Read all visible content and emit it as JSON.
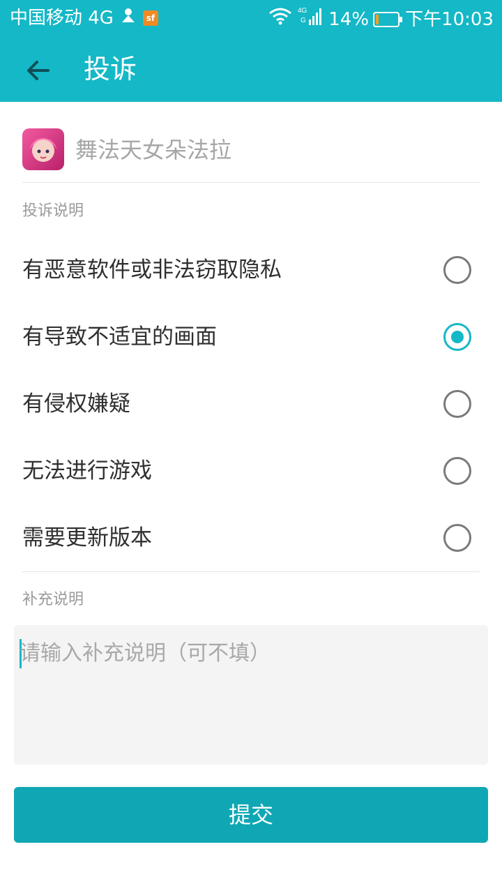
{
  "status_bar": {
    "carrier": "中国移动 4G",
    "network_small": "4G",
    "battery_percent": "14%",
    "battery_level": 0.14,
    "time": "下午10:03"
  },
  "app_bar": {
    "title": "投诉",
    "back_icon": "arrow-left-icon"
  },
  "app_info": {
    "name": "舞法天女朵法拉"
  },
  "complaint": {
    "section_label": "投诉说明",
    "options": [
      {
        "label": "有恶意软件或非法窃取隐私",
        "selected": false
      },
      {
        "label": "有导致不适宜的画面",
        "selected": true
      },
      {
        "label": "有侵权嫌疑",
        "selected": false
      },
      {
        "label": "无法进行游戏",
        "selected": false
      },
      {
        "label": "需要更新版本",
        "selected": false
      }
    ]
  },
  "supplement": {
    "section_label": "补充说明",
    "placeholder": "请输入补充说明（可不填）"
  },
  "submit": {
    "label": "提交"
  },
  "colors": {
    "accent": "#14B8C6",
    "button": "#10A7B4"
  }
}
